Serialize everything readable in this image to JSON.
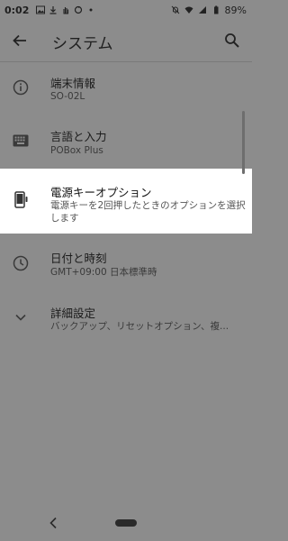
{
  "status": {
    "time": "0:02",
    "battery": "89%"
  },
  "app_bar": {
    "title": "システム",
    "back_icon": "arrow-back-icon",
    "search_icon": "search-icon"
  },
  "items": [
    {
      "label": "端末情報",
      "summary": "SO-02L",
      "icon": "info-icon"
    },
    {
      "label": "言語と入力",
      "summary": "POBox Plus",
      "icon": "keyboard-icon"
    },
    {
      "label": "電源キーオプション",
      "summary": "電源キーを2回押したときのオプションを選択します",
      "icon": "phone-power-icon",
      "highlighted": true
    },
    {
      "label": "日付と時刻",
      "summary": "GMT+09:00 日本標準時",
      "icon": "clock-icon"
    },
    {
      "label": "詳細設定",
      "summary": "バックアップ、リセットオプション、複...",
      "icon": "chevron-down-icon"
    }
  ],
  "colors": {
    "dim_background": "#8c8c8c",
    "highlight_background": "#ffffff"
  }
}
